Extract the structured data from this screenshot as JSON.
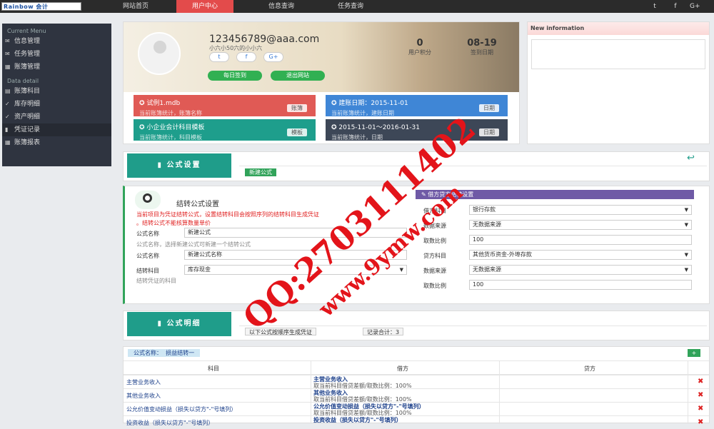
{
  "topbar": {
    "logo_text": "Rainbow 会计",
    "nav": [
      "网站首页",
      "用户中心",
      "信息查询",
      "任务查询"
    ],
    "active_nav": "用户中心",
    "social": [
      "t",
      "f",
      "G+"
    ]
  },
  "sidebar": {
    "section1": "Current Menu",
    "items1": [
      "信息管理",
      "任务管理",
      "账簿管理"
    ],
    "section2": "Data detail",
    "items2": [
      "账簿科目",
      "库存明细",
      "资产明细",
      "凭证记录",
      "账簿报表"
    ]
  },
  "profile": {
    "email": "123456789@aaa.com",
    "subtitle": "小六小50六的小小六",
    "social": [
      "t",
      "f",
      "G+"
    ],
    "btn_sign": "每日签到",
    "btn_exit": "退出网站",
    "stat1_value": "0",
    "stat1_label": "用户积分",
    "stat2_value": "08-19",
    "stat2_label": "签到日期"
  },
  "cards": [
    {
      "title": "试例1.mdb",
      "sub": "当前账簿统计，账簿名称",
      "badge": "账簿",
      "color": "#e05a55"
    },
    {
      "title": "建账日期：2015-11-01",
      "sub": "当前账簿统计，建账日期",
      "badge": "日期",
      "color": "#3f86d6"
    },
    {
      "title": "小企业会计科目模板",
      "sub": "当前账簿统计，科目模板",
      "badge": "模板",
      "color": "#1e9e8c"
    },
    {
      "title": "2015-11-01～2016-01-31",
      "sub": "当前账簿统计，日期",
      "badge": "日期",
      "color": "#3d4757"
    }
  ],
  "new_info": {
    "title": "New information"
  },
  "formula_tab": "公式设置",
  "new_formula_btn": "新建公式",
  "form": {
    "title": "结转公式设置",
    "red_line1": "当前项目为凭证结转公式，设置结转科目会按照序列的结转科目生成凭证",
    "red_line2": "。结转公式不能核算数量单价",
    "name_label": "公式名称",
    "name_value": "新建公式",
    "name_hint": "公式名称，选择新建公式可新建一个结转公式",
    "name2_label": "公式名称",
    "name2_value": "新建公式名称",
    "subject_label": "结转科目",
    "subject_value": "库存现金",
    "subject_hint": "结转凭证的科目",
    "right_header": "借方贷方结转设置",
    "debit_subject_label": "借方科目",
    "debit_subject_value": "银行存款",
    "data_src_label": "数据来源",
    "data_src_value": "无数据来源",
    "ratio_label": "取数比例",
    "ratio_value": "100",
    "credit_subject_label": "贷方科目",
    "credit_subject_value": "其他货币资金-外埠存款",
    "data_src2_label": "数据来源",
    "data_src2_value": "无数据来源",
    "ratio2_label": "取数比例",
    "ratio2_value": "100"
  },
  "detail_tab": "公式明细",
  "detail_btn1": "以下公式按顺序生成凭证",
  "detail_btn2": "记录合计：3",
  "table": {
    "formula_label": "公式名称：",
    "formula_name": "损益结转一",
    "headers": [
      "科目",
      "借方",
      "贷方"
    ],
    "rows": [
      {
        "subject": "主营业务收入",
        "debit": "主营业务收入",
        "debit_note": "取当前科目借贷差额/取数比例：100%"
      },
      {
        "subject": "其他业务收入",
        "debit": "其他业务收入",
        "debit_note": "取当前科目借贷差额/取数比例：100%"
      },
      {
        "subject": "公允价值变动损益（损失以贷方\"-\"号填列）",
        "debit": "公允价值变动损益（损失以贷方\"-\"号填列）",
        "debit_note": "取当前科目借贷差额/取数比例：100%"
      },
      {
        "subject": "投资收益（损失以贷方\"-\"号填列）",
        "debit": "投资收益（损失以贷方\"-\"号填列）",
        "debit_note": ""
      }
    ]
  },
  "watermark": {
    "line1": "QQ:2703111402",
    "line2": "www.9ymw.com"
  }
}
